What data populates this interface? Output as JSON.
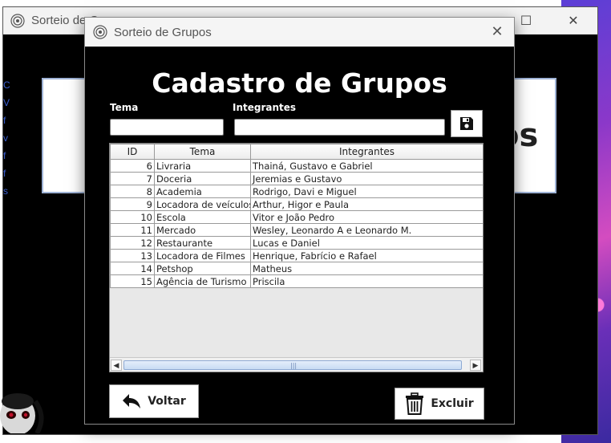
{
  "background_window": {
    "title": "Sorteio de G",
    "banner_text_partial": "os",
    "minimize_glyph": "—",
    "maximize_glyph": "☐",
    "close_glyph": "✕"
  },
  "dialog": {
    "title": "Sorteio de Grupos",
    "close_glyph": "✕",
    "heading": "Cadastro de Grupos",
    "labels": {
      "tema": "Tema",
      "integrantes": "Integrantes"
    },
    "inputs": {
      "tema_value": "",
      "integrantes_value": ""
    },
    "table": {
      "headers": [
        "ID",
        "Tema",
        "Integrantes"
      ],
      "rows": [
        {
          "id": "6",
          "tema": "Livraria",
          "integrantes": "Thainá, Gustavo e Gabriel"
        },
        {
          "id": "7",
          "tema": "Doceria",
          "integrantes": "Jeremias e Gustavo"
        },
        {
          "id": "8",
          "tema": "Academia",
          "integrantes": "Rodrigo, Davi e Miguel"
        },
        {
          "id": "9",
          "tema": "Locadora de veículos",
          "integrantes": "Arthur, Higor e Paula"
        },
        {
          "id": "10",
          "tema": "Escola",
          "integrantes": "Vitor e João Pedro"
        },
        {
          "id": "11",
          "tema": "Mercado",
          "integrantes": "Wesley, Leonardo A e Leonardo M."
        },
        {
          "id": "12",
          "tema": "Restaurante",
          "integrantes": "Lucas e Daniel"
        },
        {
          "id": "13",
          "tema": "Locadora de Filmes",
          "integrantes": "Henrique, Fabrício e Rafael"
        },
        {
          "id": "14",
          "tema": "Petshop",
          "integrantes": "Matheus"
        },
        {
          "id": "15",
          "tema": "Agência de Turismo",
          "integrantes": "Priscila"
        }
      ]
    },
    "buttons": {
      "voltar": "Voltar",
      "excluir": "Excluir"
    },
    "scroll_arrows": {
      "left": "◀",
      "right": "▶",
      "grip": "|||"
    }
  },
  "icons": {
    "app": "target-icon",
    "save": "floppy-disk-icon",
    "back": "back-arrow-icon",
    "delete": "trash-can-icon"
  },
  "colors": {
    "window_bg": "#000000",
    "heading": "#ffffff",
    "titlebar": "#f5f5f5",
    "scroll_thumb": "#c8dbf3"
  }
}
